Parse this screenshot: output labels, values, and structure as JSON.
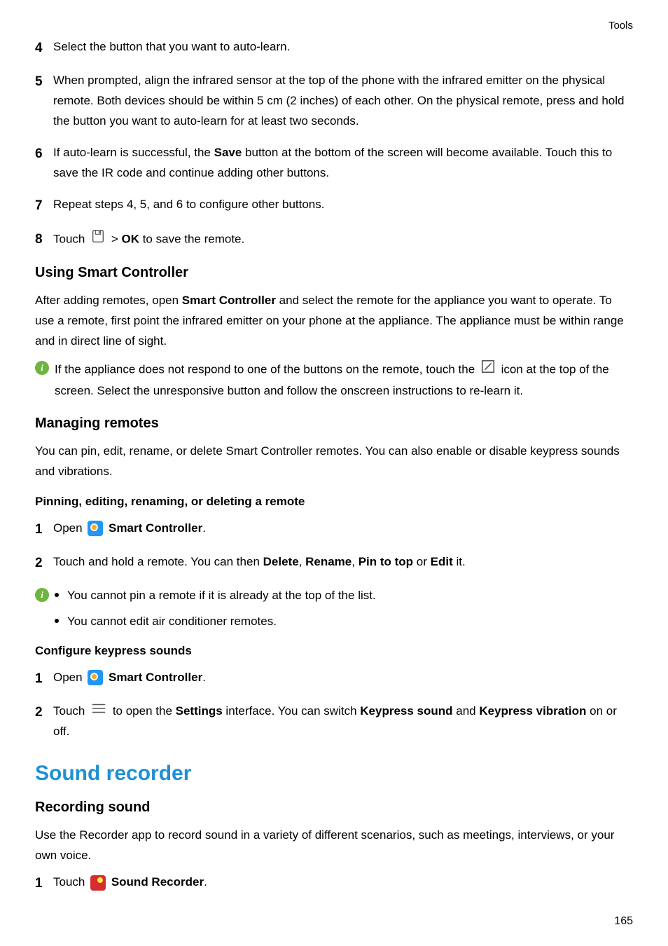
{
  "header": "Tools",
  "steps_a": [
    {
      "num": "4",
      "text": "Select the button that you want to auto-learn."
    },
    {
      "num": "5",
      "text": "When prompted, align the infrared sensor at the top of the phone with the infrared emitter on the physical remote. Both devices should be within 5 cm (2 inches) of each other. On the physical remote, press and hold the button you want to auto-learn for at least two seconds."
    },
    {
      "num": "6",
      "pre": "If auto-learn is successful, the ",
      "bold": "Save",
      "post": " button at the bottom of the screen will become available. Touch this to save the IR code and continue adding other buttons."
    },
    {
      "num": "7",
      "text": "Repeat steps 4, 5, and 6 to configure other buttons."
    },
    {
      "num": "8",
      "pre": "Touch ",
      "icon": "save",
      "mid": " > ",
      "bold": "OK",
      "post": " to save the remote."
    }
  ],
  "using": {
    "title": "Using Smart Controller",
    "para_pre": "After adding remotes, open ",
    "para_bold": "Smart Controller",
    "para_post": " and select the remote for the appliance you want to operate. To use a remote, first point the infrared emitter on your phone at the appliance. The appliance must be within range and in direct line of sight.",
    "info_pre": "If the appliance does not respond to one of the buttons on the remote, touch the ",
    "info_post": " icon at the top of the screen. Select the unresponsive button and follow the onscreen instructions to re-learn it."
  },
  "managing": {
    "title": "Managing remotes",
    "para": "You can pin, edit, rename, or delete Smart Controller remotes. You can also enable or disable keypress sounds and vibrations."
  },
  "pinning": {
    "title": "Pinning, editing, renaming, or deleting a remote",
    "step1_pre": "Open ",
    "step1_bold": "Smart Controller",
    "step1_post": ".",
    "step2_pre": "Touch and hold a remote. You can then ",
    "step2_b1": "Delete",
    "step2_m1": ", ",
    "step2_b2": "Rename",
    "step2_m2": ", ",
    "step2_b3": "Pin to top",
    "step2_m3": " or ",
    "step2_b4": "Edit",
    "step2_post": " it.",
    "note1": "You cannot pin a remote if it is already at the top of the list.",
    "note2": "You cannot edit air conditioner remotes."
  },
  "cfg": {
    "title": "Configure keypress sounds",
    "step1_pre": "Open ",
    "step1_bold": "Smart Controller",
    "step1_post": ".",
    "step2_pre": "Touch ",
    "step2_mid": " to open the ",
    "step2_b1": "Settings",
    "step2_mid2": " interface. You can switch ",
    "step2_b2": "Keypress sound",
    "step2_mid3": " and ",
    "step2_b3": "Keypress vibration",
    "step2_post": " on or off."
  },
  "recorder": {
    "h2": "Sound recorder",
    "h3": "Recording sound",
    "para": "Use the Recorder app to record sound in a variety of different scenarios, such as meetings, interviews, or your own voice.",
    "step1_pre": "Touch ",
    "step1_bold": "Sound Recorder",
    "step1_post": "."
  },
  "page": "165"
}
